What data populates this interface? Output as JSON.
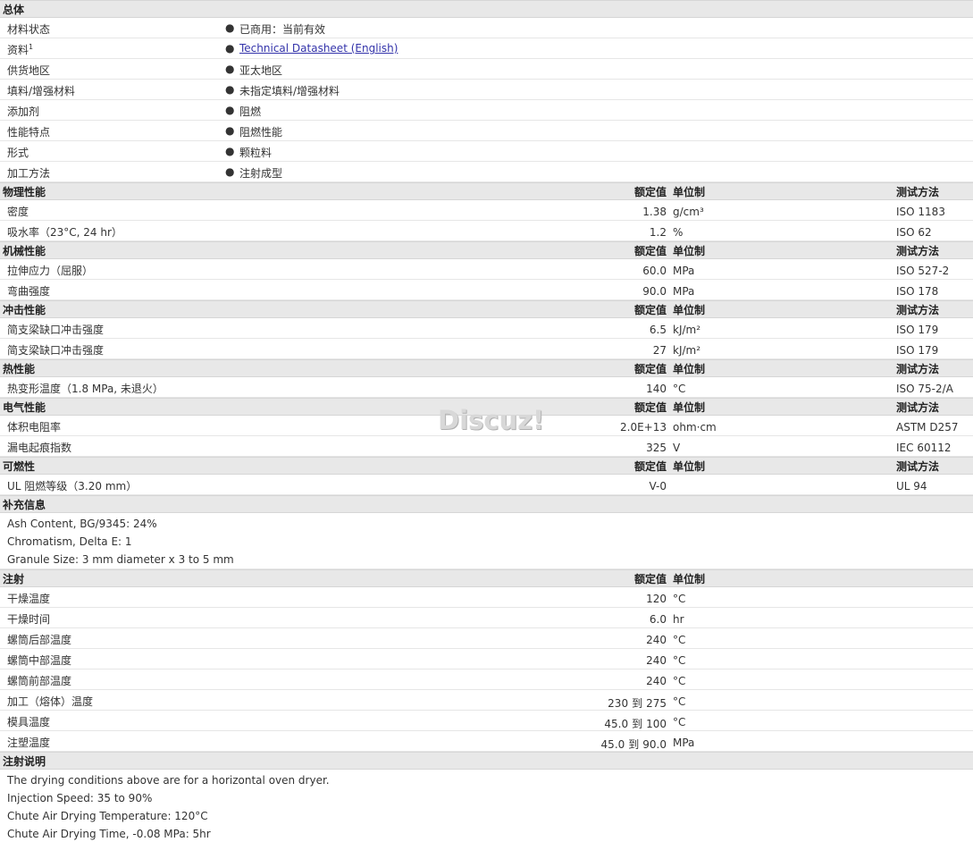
{
  "general": {
    "title": "总体",
    "rows": [
      {
        "label": "材料状态",
        "value": "已商用：当前有效"
      },
      {
        "label": "资料",
        "sup": "1",
        "value": "Technical Datasheet (English)",
        "link": true
      },
      {
        "label": "供货地区",
        "value": "亚太地区"
      },
      {
        "label": "填料/增强材料",
        "value": "未指定填料/增强材料"
      },
      {
        "label": "添加剂",
        "value": "阻燃"
      },
      {
        "label": "性能特点",
        "value": "阻燃性能"
      },
      {
        "label": "形式",
        "value": "颗粒料"
      },
      {
        "label": "加工方法",
        "value": "注射成型"
      }
    ]
  },
  "col_headers": {
    "value": "额定值",
    "unit": "单位制",
    "method": "测试方法"
  },
  "physical": {
    "title": "物理性能",
    "rows": [
      {
        "label": "密度",
        "value": "1.38",
        "unit": "g/cm³",
        "method": "ISO 1183"
      },
      {
        "label": "吸水率（23°C, 24 hr）",
        "value": "1.2",
        "unit": "%",
        "method": "ISO 62"
      }
    ]
  },
  "mechanical": {
    "title": "机械性能",
    "rows": [
      {
        "label": "拉伸应力（屈服）",
        "value": "60.0",
        "unit": "MPa",
        "method": "ISO 527-2"
      },
      {
        "label": "弯曲强度",
        "value": "90.0",
        "unit": "MPa",
        "method": "ISO 178"
      }
    ]
  },
  "impact": {
    "title": "冲击性能",
    "rows": [
      {
        "label": "简支梁缺口冲击强度",
        "value": "6.5",
        "unit": "kJ/m²",
        "method": "ISO 179"
      },
      {
        "label": "简支梁缺口冲击强度",
        "value": "27",
        "unit": "kJ/m²",
        "method": "ISO 179"
      }
    ]
  },
  "thermal": {
    "title": "热性能",
    "rows": [
      {
        "label": "热变形温度（1.8 MPa, 未退火）",
        "value": "140",
        "unit": "°C",
        "method": "ISO 75-2/A"
      }
    ]
  },
  "electrical": {
    "title": "电气性能",
    "rows": [
      {
        "label": "体积电阻率",
        "value": "2.0E+13",
        "unit": "ohm·cm",
        "method": "ASTM D257"
      },
      {
        "label": "漏电起痕指数",
        "value": "325",
        "unit": "V",
        "method": "IEC 60112"
      }
    ]
  },
  "flammability": {
    "title": "可燃性",
    "rows": [
      {
        "label": "UL 阻燃等级（3.20 mm）",
        "value": "V-0",
        "unit": "",
        "method": "UL 94"
      }
    ]
  },
  "supplemental": {
    "title": "补充信息",
    "lines": [
      "Ash Content, BG/9345: 24%",
      "Chromatism, Delta E: 1",
      "Granule Size: 3 mm diameter x 3 to 5 mm"
    ]
  },
  "injection": {
    "title": "注射",
    "to_word": "到",
    "rows": [
      {
        "label": "干燥温度",
        "value": "120",
        "unit": "°C"
      },
      {
        "label": "干燥时间",
        "value": "6.0",
        "unit": "hr"
      },
      {
        "label": "螺筒后部温度",
        "value": "240",
        "unit": "°C"
      },
      {
        "label": "螺筒中部温度",
        "value": "240",
        "unit": "°C"
      },
      {
        "label": "螺筒前部温度",
        "value": "240",
        "unit": "°C"
      },
      {
        "label": "加工（熔体）温度",
        "value_from": "230",
        "value_to": "275",
        "unit": "°C"
      },
      {
        "label": "模具温度",
        "value_from": "45.0",
        "value_to": "100",
        "unit": "°C"
      },
      {
        "label": "注塑温度",
        "value_from": "45.0",
        "value_to": "90.0",
        "unit": "MPa"
      }
    ]
  },
  "injection_notes": {
    "title": "注射说明",
    "lines": [
      "The drying conditions above are for a horizontal oven dryer.",
      "Injection Speed: 35 to 90%",
      "Chute Air Drying Temperature: 120°C",
      "Chute Air Drying Time, -0.08 MPa: 5hr"
    ]
  },
  "watermark": "Discuz!"
}
